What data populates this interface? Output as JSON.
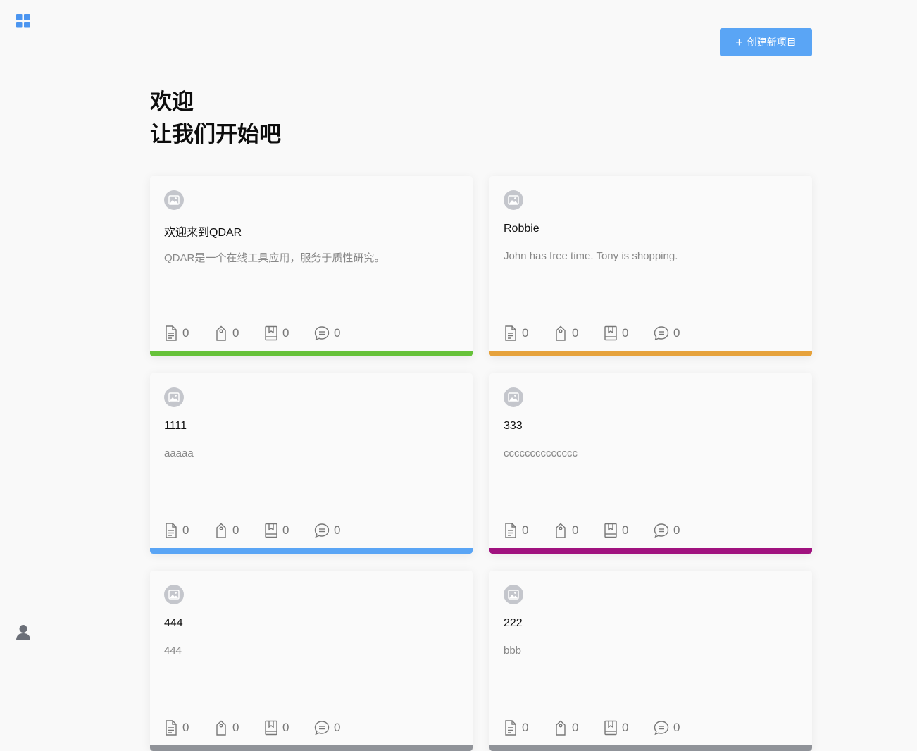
{
  "header": {
    "create_button_label": "创建新项目"
  },
  "welcome": {
    "line1": "欢迎",
    "line2": "让我们开始吧"
  },
  "projects": [
    {
      "title": "欢迎来到QDAR",
      "desc": "QDAR是一个在线工具应用，服务于质性研究。",
      "docs": "0",
      "codes": "0",
      "memos": "0",
      "comments": "0",
      "color": "#67c23a"
    },
    {
      "title": "Robbie",
      "desc": "John has free time. Tony is shopping.",
      "docs": "0",
      "codes": "0",
      "memos": "0",
      "comments": "0",
      "color": "#e6a23c"
    },
    {
      "title": "1111",
      "desc": "aaaaa",
      "docs": "0",
      "codes": "0",
      "memos": "0",
      "comments": "0",
      "color": "#5aa5f5"
    },
    {
      "title": "333",
      "desc": "cccccccccccccc",
      "docs": "0",
      "codes": "0",
      "memos": "0",
      "comments": "0",
      "color": "#a0127f"
    },
    {
      "title": "444",
      "desc": "444",
      "docs": "0",
      "codes": "0",
      "memos": "0",
      "comments": "0",
      "color": "#909399"
    },
    {
      "title": "222",
      "desc": "bbb",
      "docs": "0",
      "codes": "0",
      "memos": "0",
      "comments": "0",
      "color": "#909399"
    }
  ],
  "icons": {
    "apps": "apps-grid-icon",
    "user": "user-icon",
    "avatar": "image-placeholder-icon",
    "docs": "document-icon",
    "codes": "tag-icon",
    "memos": "bookmark-book-icon",
    "comments": "comment-icon"
  },
  "colors": {
    "accent": "#5aa5f5",
    "background": "#f9f9f9"
  }
}
